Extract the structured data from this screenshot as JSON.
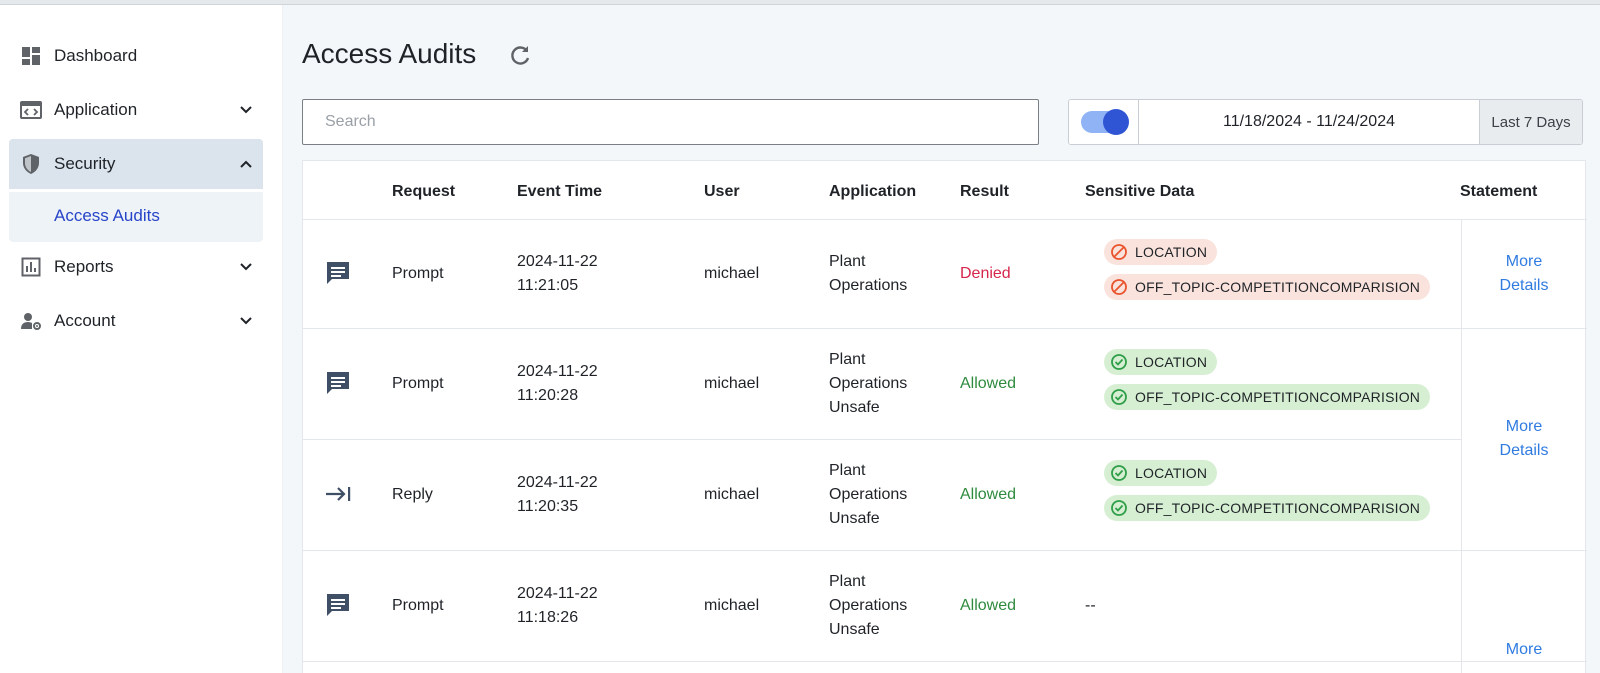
{
  "sidebar": {
    "items": [
      {
        "label": "Dashboard",
        "icon": "dashboard-icon"
      },
      {
        "label": "Application",
        "icon": "application-code-icon"
      },
      {
        "label": "Security",
        "icon": "shield-icon"
      },
      {
        "label": "Reports",
        "icon": "bar-chart-icon"
      },
      {
        "label": "Account",
        "icon": "user-settings-icon"
      }
    ],
    "sub_item": "Access Audits"
  },
  "main": {
    "title": "Access Audits",
    "search_placeholder": "Search",
    "date_range": "11/18/2024 - 11/24/2024",
    "date_preset": "Last 7 Days",
    "toggle_on": true
  },
  "table": {
    "headers": [
      "Request",
      "Event Time",
      "User",
      "Application",
      "Result",
      "Sensitive Data",
      "Statement"
    ],
    "rows": [
      {
        "request": "Prompt",
        "request_icon": "chat-icon",
        "time_date": "2024-11-22",
        "time_clock": "11:21:05",
        "user": "michael",
        "app_line1": "Plant",
        "app_line2": "Operations",
        "app_line3": "",
        "result": "Denied",
        "chips": [
          "LOCATION",
          "OFF_TOPIC-COMPETITIONCOMPARISION"
        ],
        "chip_status": "blocked",
        "empty_marker": ""
      },
      {
        "request": "Prompt",
        "request_icon": "chat-icon",
        "time_date": "2024-11-22",
        "time_clock": "11:20:28",
        "user": "michael",
        "app_line1": "Plant",
        "app_line2": "Operations",
        "app_line3": "Unsafe",
        "result": "Allowed",
        "chips": [
          "LOCATION",
          "OFF_TOPIC-COMPETITIONCOMPARISION"
        ],
        "chip_status": "allowed",
        "empty_marker": ""
      },
      {
        "request": "Reply",
        "request_icon": "arrow-right-to-bar-icon",
        "time_date": "2024-11-22",
        "time_clock": "11:20:35",
        "user": "michael",
        "app_line1": "Plant",
        "app_line2": "Operations",
        "app_line3": "Unsafe",
        "result": "Allowed",
        "chips": [
          "LOCATION",
          "OFF_TOPIC-COMPETITIONCOMPARISION"
        ],
        "chip_status": "allowed",
        "empty_marker": ""
      },
      {
        "request": "Prompt",
        "request_icon": "chat-icon",
        "time_date": "2024-11-22",
        "time_clock": "11:18:26",
        "user": "michael",
        "app_line1": "Plant",
        "app_line2": "Operations",
        "app_line3": "Unsafe",
        "result": "Allowed",
        "chips": [],
        "chip_status": "",
        "empty_marker": "--"
      }
    ],
    "statement_links": [
      {
        "line1": "More",
        "line2": "Details"
      },
      {
        "line1": "More",
        "line2": "Details"
      },
      {
        "line1": "More",
        "line2": ""
      }
    ]
  },
  "colors": {
    "accent": "#2f55d4",
    "denied": "#d6264b",
    "allowed": "#2e8b3e",
    "link": "#2f7be0"
  }
}
